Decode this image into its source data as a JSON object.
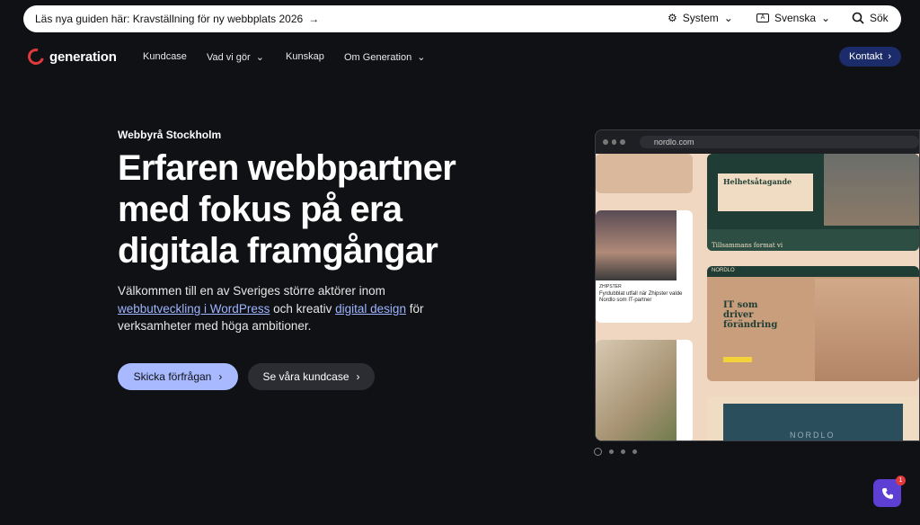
{
  "announcement": {
    "text": "Läs nya guiden här: Kravställning för ny webbplats 2026"
  },
  "utility": {
    "theme_label": "System",
    "language_label": "Svenska",
    "search_label": "Sök"
  },
  "nav": {
    "logo_text": "generation",
    "items": [
      {
        "label": "Kundcase"
      },
      {
        "label": "Vad vi gör"
      },
      {
        "label": "Kunskap"
      },
      {
        "label": "Om Generation"
      }
    ],
    "contact_label": "Kontakt"
  },
  "hero": {
    "eyebrow": "Webbyrå Stockholm",
    "title": "Erfaren webbpartner med fokus på era digitala framgångar",
    "lead_pre": "Välkommen till en av Sveriges större aktörer inom",
    "lead_link1": "webbutveckling i WordPress",
    "lead_mid": "och kreativ",
    "lead_link2": "digital design",
    "lead_post": "för verksamheter med höga ambitioner.",
    "primary_cta": "Skicka förfrågan",
    "secondary_cta": "Se våra kundcase"
  },
  "showcase": {
    "url": "nordlo.com",
    "card1_heading": "Helhetsåtagande",
    "card2_heading": "Tillsammans format vi",
    "card3_brand": "NORDLO",
    "card3_heading": "IT som driver förändring",
    "card4_brand": "NORDLO",
    "card_left_caption": "Fyrdubblat utfall när Zhipster valde Nordlo som IT-partner",
    "card_left_brand": "ZHIPSTER"
  },
  "chat": {
    "badge_count": "1"
  },
  "colors": {
    "background": "#0f1115",
    "primary_button": "#a8b9ff",
    "contact_button": "#1c2c6b",
    "chat_button": "#5d3fd3",
    "logo_red": "#e23a3a"
  }
}
